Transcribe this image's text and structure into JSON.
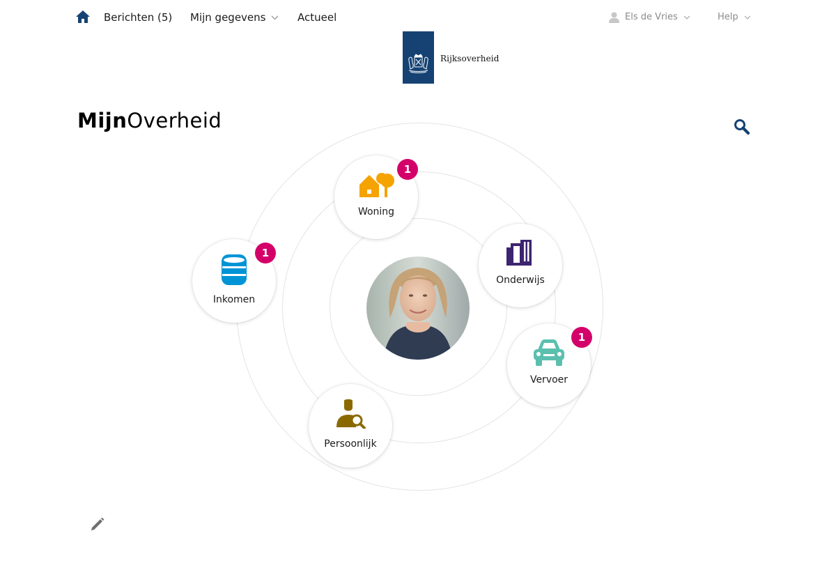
{
  "nav": {
    "home_icon": "home-icon",
    "berichten_label": "Berichten (5)",
    "gegevens_label": "Mijn gegevens",
    "actueel_label": "Actueel",
    "user_label": "Els de Vries",
    "help_label": "Help"
  },
  "logo": {
    "text": "Rijksoverheid",
    "color": "#154273"
  },
  "brand": {
    "part1": "Mijn",
    "part2": "Overheid"
  },
  "categories": [
    {
      "label": "Woning",
      "icon": "house-tree-icon",
      "color": "#f5a300",
      "badge": "1"
    },
    {
      "label": "Inkomen",
      "icon": "coins-icon",
      "color": "#0094d6",
      "badge": "1"
    },
    {
      "label": "Onderwijs",
      "icon": "books-icon",
      "color": "#3d2470",
      "badge": null
    },
    {
      "label": "Vervoer",
      "icon": "car-icon",
      "color": "#5bbfae",
      "badge": "1"
    },
    {
      "label": "Persoonlijk",
      "icon": "person-search-icon",
      "color": "#8a6a00",
      "badge": null
    }
  ],
  "colors": {
    "badge": "#d4006a",
    "nav_accent": "#154273"
  }
}
